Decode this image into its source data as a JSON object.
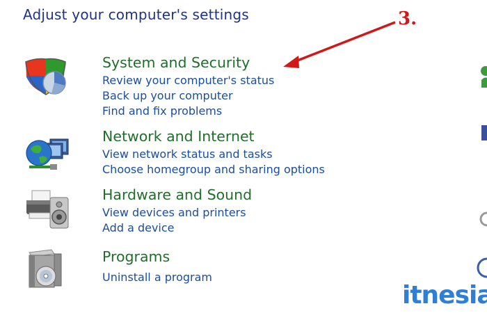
{
  "header": {
    "title": "Adjust your computer's settings"
  },
  "annotation": {
    "label": "3.",
    "color": "#d01818"
  },
  "categories": [
    {
      "title": "System and Security",
      "icon": "shield-icon",
      "links": [
        "Review your computer's status",
        "Back up your computer",
        "Find and fix problems"
      ]
    },
    {
      "title": "Network and Internet",
      "icon": "globe-network-icon",
      "links": [
        "View network status and tasks",
        "Choose homegroup and sharing options"
      ]
    },
    {
      "title": "Hardware and Sound",
      "icon": "printer-speaker-icon",
      "links": [
        "View devices and printers",
        "Add a device"
      ]
    },
    {
      "title": "Programs",
      "icon": "programs-box-icon",
      "links": [
        "Uninstall a program"
      ]
    }
  ],
  "watermark": {
    "text": "itnesia"
  },
  "colors": {
    "heading": "#1f6e2a",
    "link": "#1a4ea0",
    "title": "#1e3287"
  }
}
